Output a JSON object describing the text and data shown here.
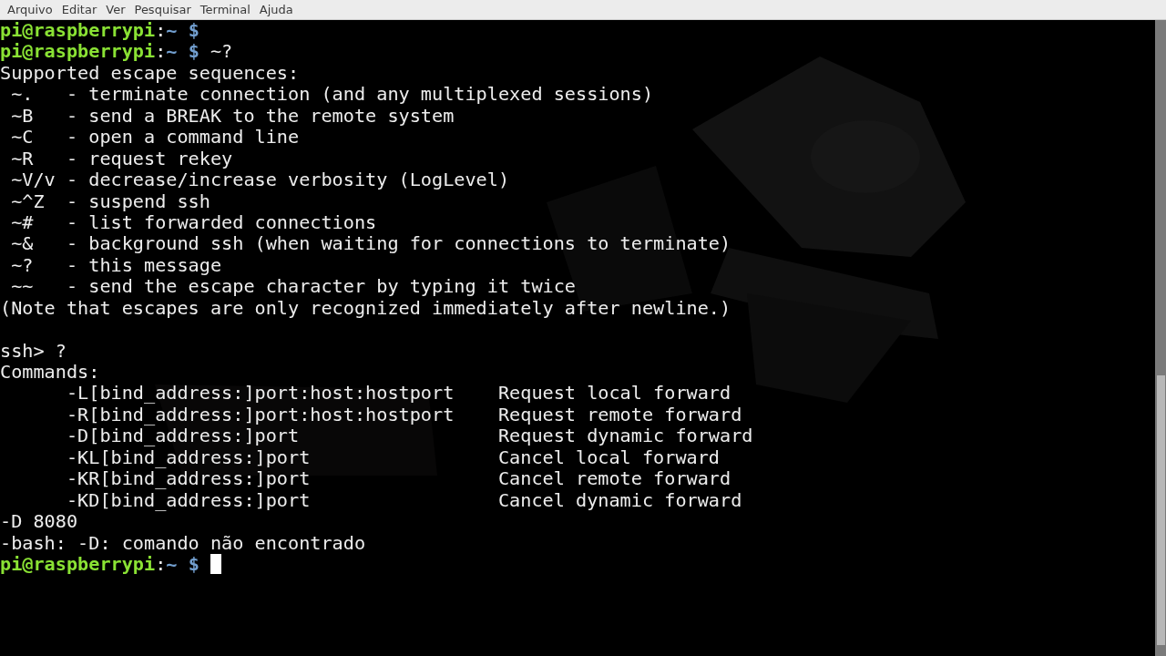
{
  "menu_bar": [
    "Arquivo",
    "Editar",
    "Ver",
    "Pesquisar",
    "Terminal",
    "Ajuda"
  ],
  "lines": [
    {
      "kind": "prompt",
      "user": "pi@raspberrypi",
      "separator": ":",
      "path": "~",
      "symbol": "$",
      "cursor": false
    },
    {
      "kind": "prompt",
      "user": "pi@raspberrypi",
      "separator": ":",
      "path": "~",
      "symbol": "$",
      "command": "~?",
      "cursor": false
    },
    {
      "kind": "output",
      "text": "Supported escape sequences:"
    },
    {
      "kind": "output",
      "text": " ~.   - terminate connection (and any multiplexed sessions)"
    },
    {
      "kind": "output",
      "text": " ~B   - send a BREAK to the remote system"
    },
    {
      "kind": "output",
      "text": " ~C   - open a command line"
    },
    {
      "kind": "output",
      "text": " ~R   - request rekey"
    },
    {
      "kind": "output",
      "text": " ~V/v - decrease/increase verbosity (LogLevel)"
    },
    {
      "kind": "output",
      "text": " ~^Z  - suspend ssh"
    },
    {
      "kind": "output",
      "text": " ~#   - list forwarded connections"
    },
    {
      "kind": "output",
      "text": " ~&   - background ssh (when waiting for connections to terminate)"
    },
    {
      "kind": "output",
      "text": " ~?   - this message"
    },
    {
      "kind": "output",
      "text": " ~~   - send the escape character by typing it twice"
    },
    {
      "kind": "output",
      "text": "(Note that escapes are only recognized immediately after newline.)"
    },
    {
      "kind": "blank"
    },
    {
      "kind": "output",
      "text": "ssh> ?"
    },
    {
      "kind": "output",
      "text": "Commands:"
    },
    {
      "kind": "option",
      "option": "-L[bind_address:]port:host:hostport",
      "description": "Request local forward"
    },
    {
      "kind": "option",
      "option": "-R[bind_address:]port:host:hostport",
      "description": "Request remote forward"
    },
    {
      "kind": "option",
      "option": "-D[bind_address:]port",
      "description": "Request dynamic forward"
    },
    {
      "kind": "option",
      "option": "-KL[bind_address:]port",
      "description": "Cancel local forward"
    },
    {
      "kind": "option",
      "option": "-KR[bind_address:]port",
      "description": "Cancel remote forward"
    },
    {
      "kind": "option",
      "option": "-KD[bind_address:]port",
      "description": "Cancel dynamic forward"
    },
    {
      "kind": "output",
      "text": "-D 8080"
    },
    {
      "kind": "output",
      "text": "-bash: -D: comando não encontrado"
    },
    {
      "kind": "prompt",
      "user": "pi@raspberrypi",
      "separator": ":",
      "path": "~",
      "symbol": "$",
      "cursor": true
    }
  ]
}
